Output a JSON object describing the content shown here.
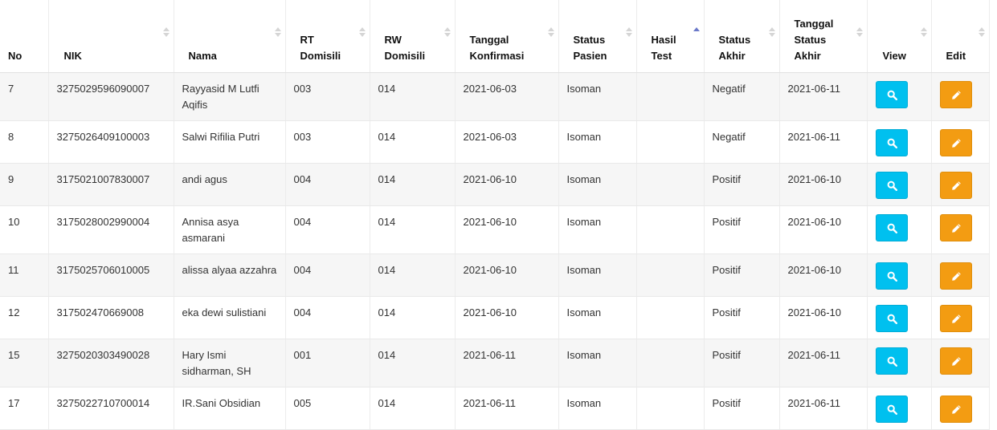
{
  "columns": [
    "No",
    "NIK",
    "Nama",
    "RT Domisili",
    "RW Domisili",
    "Tanggal Konfirmasi",
    "Status Pasien",
    "Hasil Test",
    "Status Akhir",
    "Tanggal Status Akhir",
    "View",
    "Edit"
  ],
  "rows": [
    {
      "no": "7",
      "nik": "3275029596090007",
      "nama": "Rayyasid M Lutfi Aqifis",
      "rt": "003",
      "rw": "014",
      "tanggal_konfirmasi": "2021-06-03",
      "status_pasien": "Isoman",
      "hasil_test": "",
      "status_akhir": "Negatif",
      "tanggal_status_akhir": "2021-06-11"
    },
    {
      "no": "8",
      "nik": "3275026409100003",
      "nama": "Salwi Rifilia Putri",
      "rt": "003",
      "rw": "014",
      "tanggal_konfirmasi": "2021-06-03",
      "status_pasien": "Isoman",
      "hasil_test": "",
      "status_akhir": "Negatif",
      "tanggal_status_akhir": "2021-06-11"
    },
    {
      "no": "9",
      "nik": "3175021007830007",
      "nama": "andi agus",
      "rt": "004",
      "rw": "014",
      "tanggal_konfirmasi": "2021-06-10",
      "status_pasien": "Isoman",
      "hasil_test": "",
      "status_akhir": "Positif",
      "tanggal_status_akhir": "2021-06-10"
    },
    {
      "no": "10",
      "nik": "3175028002990004",
      "nama": "Annisa asya asmarani",
      "rt": "004",
      "rw": "014",
      "tanggal_konfirmasi": "2021-06-10",
      "status_pasien": "Isoman",
      "hasil_test": "",
      "status_akhir": "Positif",
      "tanggal_status_akhir": "2021-06-10"
    },
    {
      "no": "11",
      "nik": "3175025706010005",
      "nama": "alissa alyaa azzahra",
      "rt": "004",
      "rw": "014",
      "tanggal_konfirmasi": "2021-06-10",
      "status_pasien": "Isoman",
      "hasil_test": "",
      "status_akhir": "Positif",
      "tanggal_status_akhir": "2021-06-10"
    },
    {
      "no": "12",
      "nik": "317502470669008",
      "nama": "eka dewi sulistiani",
      "rt": "004",
      "rw": "014",
      "tanggal_konfirmasi": "2021-06-10",
      "status_pasien": "Isoman",
      "hasil_test": "",
      "status_akhir": "Positif",
      "tanggal_status_akhir": "2021-06-10"
    },
    {
      "no": "15",
      "nik": "3275020303490028",
      "nama": "Hary Ismi sidharman, SH",
      "rt": "001",
      "rw": "014",
      "tanggal_konfirmasi": "2021-06-11",
      "status_pasien": "Isoman",
      "hasil_test": "",
      "status_akhir": "Positif",
      "tanggal_status_akhir": "2021-06-11"
    },
    {
      "no": "17",
      "nik": "3275022710700014",
      "nama": "IR.Sani Obsidian",
      "rt": "005",
      "rw": "014",
      "tanggal_konfirmasi": "2021-06-11",
      "status_pasien": "Isoman",
      "hasil_test": "",
      "status_akhir": "Positif",
      "tanggal_status_akhir": "2021-06-11"
    }
  ],
  "sorted_column": "Hasil Test",
  "sort_direction": "ascending",
  "icons": {
    "view": "search-icon",
    "edit": "pencil-icon"
  },
  "colors": {
    "view_button": "#00c0ef",
    "edit_button": "#f39c12",
    "sort_active": "#6b79c9"
  }
}
